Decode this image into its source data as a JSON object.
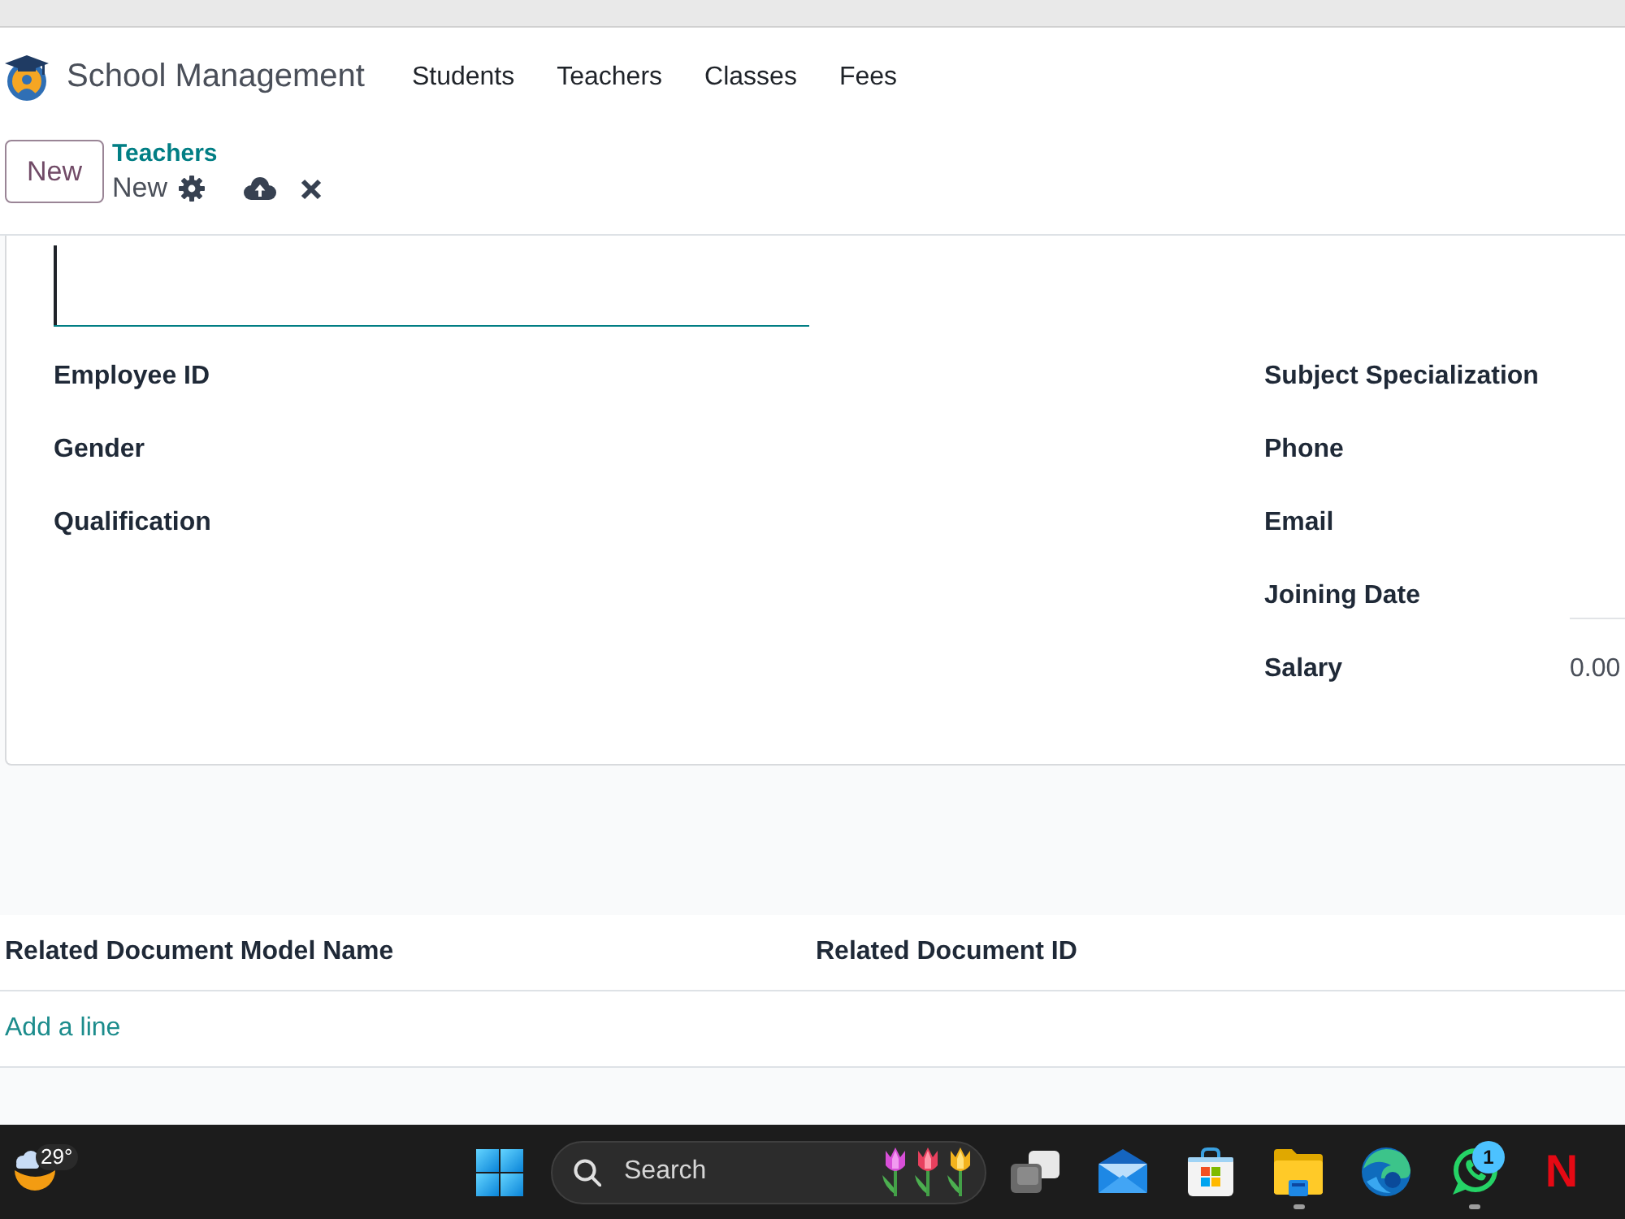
{
  "app": {
    "title": "School Management",
    "menu": [
      "Students",
      "Teachers",
      "Classes",
      "Fees"
    ]
  },
  "control_panel": {
    "new_button": "New",
    "breadcrumb": {
      "parent": "Teachers",
      "current": "New"
    }
  },
  "form": {
    "name_field": {
      "focused": true
    },
    "left_fields": [
      {
        "label": "Employee ID"
      },
      {
        "label": "Gender"
      },
      {
        "label": "Qualification"
      }
    ],
    "right_fields": [
      {
        "label": "Subject Specialization",
        "kind": "text"
      },
      {
        "label": "Phone",
        "kind": "text"
      },
      {
        "label": "Email",
        "kind": "text"
      },
      {
        "label": "Joining Date",
        "kind": "date"
      },
      {
        "label": "Salary",
        "kind": "monetary",
        "value": "0.00"
      }
    ]
  },
  "related_documents": {
    "columns": [
      "Related Document Model Name",
      "Related Document ID"
    ],
    "add_line": "Add a line"
  },
  "taskbar": {
    "weather": {
      "temperature": "29°"
    },
    "search": {
      "label": "Search"
    },
    "apps": [
      {
        "kind": "taskview",
        "running": false
      },
      {
        "kind": "mail",
        "running": false
      },
      {
        "kind": "store",
        "running": false
      },
      {
        "kind": "folder",
        "running": true
      },
      {
        "kind": "edge",
        "running": false
      },
      {
        "kind": "whatsapp",
        "running": true,
        "badge": "1"
      },
      {
        "kind": "letter",
        "running": false,
        "label": "N"
      }
    ]
  }
}
